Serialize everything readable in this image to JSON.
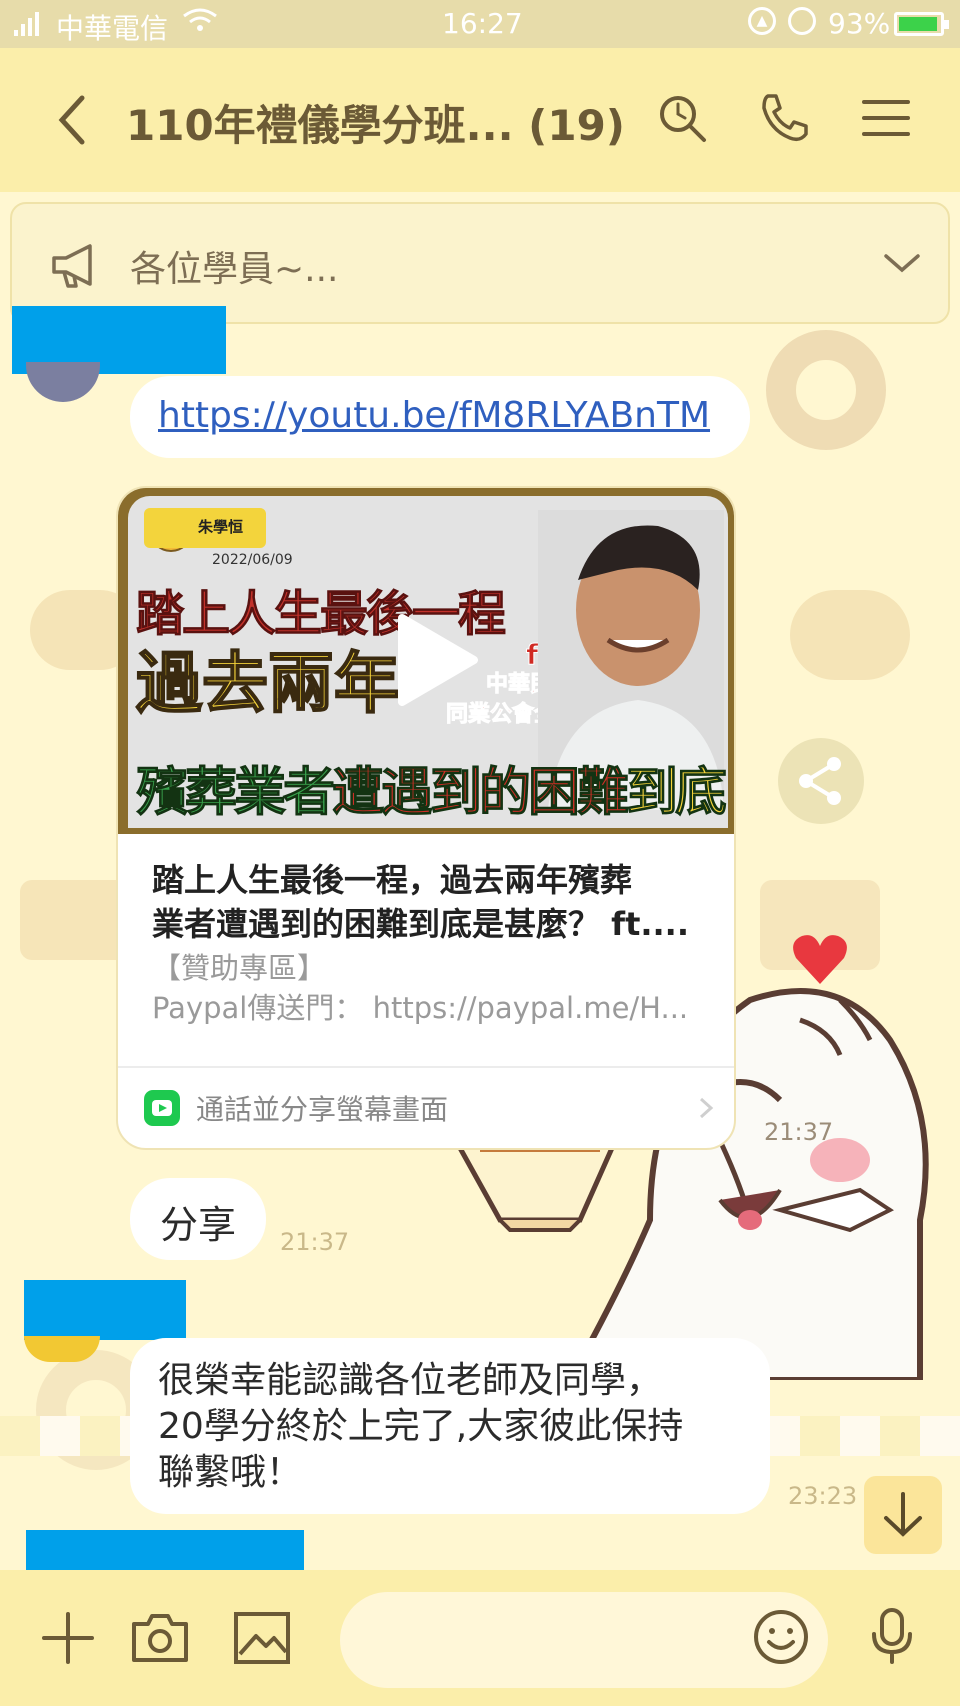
{
  "status_bar": {
    "carrier": "中華電信",
    "time": "16:27",
    "battery": "93%",
    "battery_level": 0.93
  },
  "header": {
    "title": "110年禮儀學分班... (19)"
  },
  "announcement": {
    "text": "各位學員~..."
  },
  "messages": {
    "link_url": "https://youtu.be/fM8RLYABnTM",
    "card": {
      "title_line1": "踏上人生最後一程，過去兩年殯葬",
      "title_line2": "業者遭遇到的困難到底是甚麼？ ft....",
      "desc_line1": "【贊助專區】",
      "desc_line2": "Paypal傳送門： https://paypal.me/H...",
      "action": "通話並分享螢幕畫面",
      "thumb": {
        "channel": "朱學恒",
        "date": "2022/06/09",
        "headline1": "踏上人生最後一程",
        "headline2": "過去兩年",
        "headline3_a": "殯葬業者",
        "headline3_b": "遭遇到的困難",
        "headline3_c": "到底是甚麼?",
        "guest_line1": "ft.李濂淞",
        "guest_line2": "中華民國殯儀商業",
        "guest_line3": "同業公會全國聯合會理事長"
      }
    },
    "share_text": "分享",
    "share_time": "21:37",
    "sticker_time": "21:37",
    "msg_line1": "很榮幸能認識各位老師及同學，",
    "msg_line2": "20學分終於上完了,大家彼此保持",
    "msg_line3": "聯繫哦！",
    "msg_time": "23:23"
  },
  "colors": {
    "header_bg": "#fbeeaa",
    "redaction": "#00a0ea",
    "link": "#2f5fbf",
    "action_green": "#1ec94f"
  }
}
